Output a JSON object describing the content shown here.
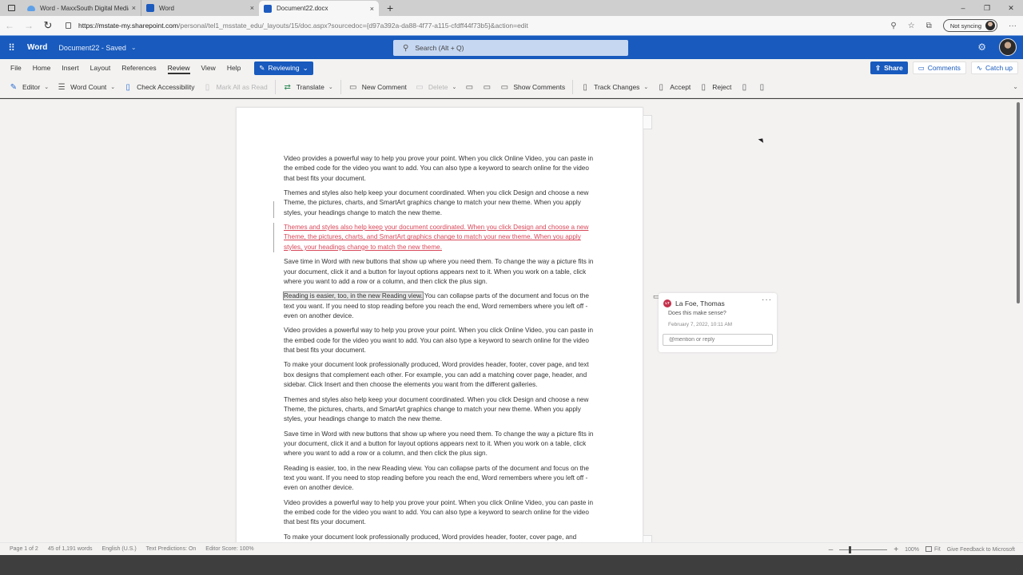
{
  "browser": {
    "tabs": [
      {
        "title": "Word - MaxxSouth Digital Media",
        "icon": "cloud-icon",
        "active": false
      },
      {
        "title": "Word",
        "icon": "word-icon",
        "active": false
      },
      {
        "title": "Document22.docx",
        "icon": "word-icon",
        "active": true
      }
    ],
    "close_glyph": "×",
    "new_tab_glyph": "+",
    "window_controls": {
      "minimize": "–",
      "restore": "❐",
      "close": "✕"
    },
    "url_host": "https://mstate-my.sharepoint.com",
    "url_path": "/personal/tel1_msstate_edu/_layouts/15/doc.aspx?sourcedoc={d97a392a-da88-4f77-a115-cfdff44f73b5}&action=edit",
    "sync_label": "Not syncing",
    "more_glyph": "···"
  },
  "word_header": {
    "app_name": "Word",
    "doc_status": "Document22 - Saved",
    "search_placeholder": "Search (Alt + Q)"
  },
  "ribbon_tabs": {
    "tabs": [
      "File",
      "Home",
      "Insert",
      "Layout",
      "References",
      "Review",
      "View",
      "Help"
    ],
    "active": "Review",
    "mode_button": "Reviewing",
    "share": "Share",
    "comments": "Comments",
    "catch_up": "Catch up"
  },
  "ribbon": {
    "editor": "Editor",
    "word_count": "Word Count",
    "check_accessibility": "Check Accessibility",
    "mark_all_read": "Mark All as Read",
    "translate": "Translate",
    "new_comment": "New Comment",
    "delete": "Delete",
    "show_comments": "Show Comments",
    "track_changes": "Track Changes",
    "accept": "Accept",
    "reject": "Reject"
  },
  "document": {
    "paragraphs": [
      {
        "text": "Video provides a powerful way to help you prove your point. When you click Online Video, you can paste in the embed code for the video you want to add. You can also type a keyword to search online for the video that best fits your document.",
        "state": "normal"
      },
      {
        "text": "Themes and styles also help keep your document coordinated. When you click Design and choose a new Theme, the pictures, charts, and SmartArt graphics change to match your new theme. When you apply styles, your headings change to match the new theme.",
        "state": "changed"
      },
      {
        "text": "Themes and styles also help keep your document coordinated. When you click Design and choose a new Theme, the pictures, charts, and SmartArt graphics change to match your new theme. When you apply styles, your headings change to match the new theme.",
        "state": "deleted"
      },
      {
        "text": "Save time in Word with new buttons that show up where you need them. To change the way a picture fits in your document, click it and a button for layout options appears next to it. When you work on a table, click where you want to add a row or a column, and then click the plus sign.",
        "state": "normal"
      },
      {
        "highlight": "Reading is easier, too, in the new Reading view.",
        "text": " You can collapse parts of the document and focus on the text you want. If you need to stop reading before you reach the end, Word remembers where you left off - even on another device.",
        "state": "commented"
      },
      {
        "text": "Video provides a powerful way to help you prove your point. When you click Online Video, you can paste in the embed code for the video you want to add. You can also type a keyword to search online for the video that best fits your document.",
        "state": "normal"
      },
      {
        "text": "To make your document look professionally produced, Word provides header, footer, cover page, and text box designs that complement each other. For example, you can add a matching cover page, header, and sidebar. Click Insert and then choose the elements you want from the different galleries.",
        "state": "normal"
      },
      {
        "text": "Themes and styles also help keep your document coordinated. When you click Design and choose a new Theme, the pictures, charts, and SmartArt graphics change to match your new theme. When you apply styles, your headings change to match the new theme.",
        "state": "normal"
      },
      {
        "text": "Save time in Word with new buttons that show up where you need them. To change the way a picture fits in your document, click it and a button for layout options appears next to it. When you work on a table, click where you want to add a row or a column, and then click the plus sign.",
        "state": "normal"
      },
      {
        "text": "Reading is easier, too, in the new Reading view. You can collapse parts of the document and focus on the text you want. If you need to stop reading before you reach the end, Word remembers where you left off - even on another device.",
        "state": "normal"
      },
      {
        "text": "Video provides a powerful way to help you prove your point. When you click Online Video, you can paste in the embed code for the video you want to add. You can also type a keyword to search online for the video that best fits your document.",
        "state": "normal"
      },
      {
        "text": "To make your document look professionally produced, Word provides header, footer, cover page, and",
        "state": "normal"
      }
    ]
  },
  "comment": {
    "initials": "LT",
    "author": "La Foe, Thomas",
    "text": "Does this make sense?",
    "date": "February 7, 2022, 10:11 AM",
    "reply_placeholder": "@mention or reply",
    "more_glyph": "···"
  },
  "status_bar": {
    "page": "Page 1 of 2",
    "words": "45 of 1,191 words",
    "language": "English (U.S.)",
    "text_predictions": "Text Predictions: On",
    "editor_score": "Editor Score: 100%",
    "zoom_level": "100%",
    "zoom_fraction": 0.2,
    "fit": "Fit",
    "feedback": "Give Feedback to Microsoft"
  },
  "colors": {
    "brand": "#185abd",
    "deleted_text": "#d8485a",
    "comment_avatar": "#c4314b"
  }
}
